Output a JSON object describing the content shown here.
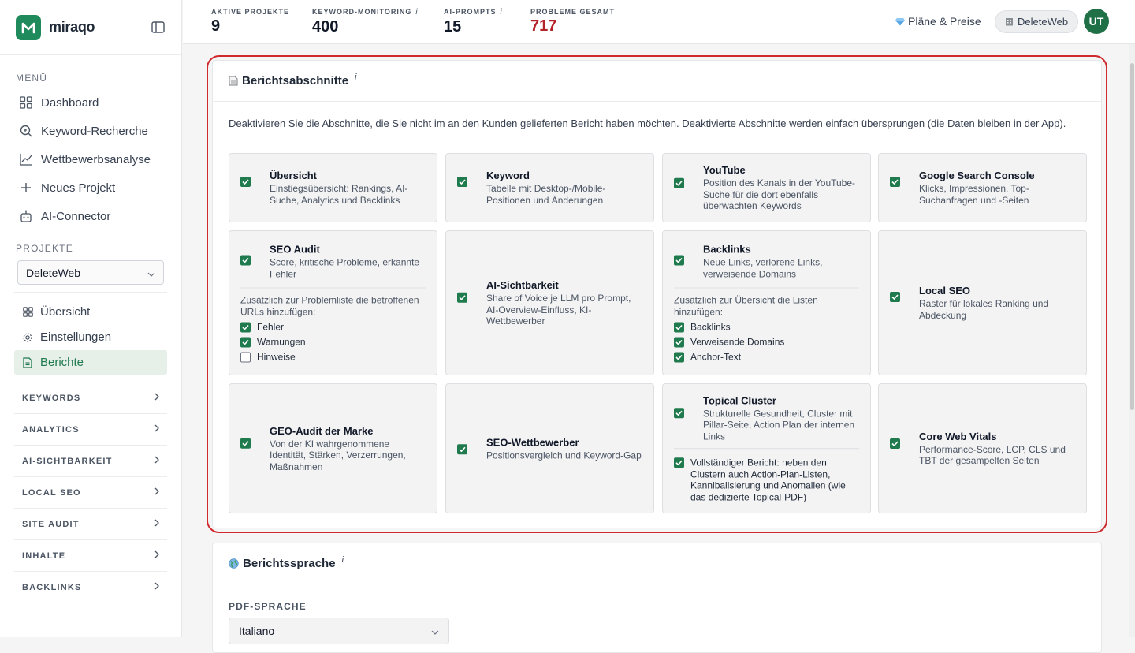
{
  "brand": {
    "name": "miraqo"
  },
  "menu": {
    "title": "MENÜ",
    "items": [
      {
        "label": "Dashboard",
        "icon": "grid-icon"
      },
      {
        "label": "Keyword-Recherche",
        "icon": "search-icon"
      },
      {
        "label": "Wettbewerbsanalyse",
        "icon": "chart-icon"
      },
      {
        "label": "Neues Projekt",
        "icon": "plus-icon"
      },
      {
        "label": "AI-Connector",
        "icon": "robot-icon"
      }
    ]
  },
  "projects": {
    "title": "PROJEKTE",
    "selected": "DeleteWeb",
    "sub_items": [
      {
        "label": "Übersicht",
        "icon": "grid-icon"
      },
      {
        "label": "Einstellungen",
        "icon": "gear-icon"
      },
      {
        "label": "Berichte",
        "icon": "document-icon",
        "active": true
      }
    ],
    "groups": [
      "KEYWORDS",
      "ANALYTICS",
      "AI-SICHTBARKEIT",
      "LOCAL SEO",
      "SITE AUDIT",
      "INHALTE",
      "BACKLINKS"
    ]
  },
  "stats": [
    {
      "label": "AKTIVE PROJEKTE",
      "value": "9",
      "info": "",
      "alert": false
    },
    {
      "label": "KEYWORD-MONITORING",
      "value": "400",
      "info": "i",
      "alert": false
    },
    {
      "label": "AI-PROMPTS",
      "value": "15",
      "info": "i",
      "alert": false
    },
    {
      "label": "PROBLEME GESAMT",
      "value": "717",
      "info": "",
      "alert": true
    }
  ],
  "header": {
    "plans_label": "Pläne & Preise",
    "workspace_label": "DeleteWeb",
    "avatar_initials": "UT"
  },
  "sections_card": {
    "title": "Berichtsabschnitte",
    "info": "i",
    "description": "Deaktivieren Sie die Abschnitte, die Sie nicht im an den Kunden gelieferten Bericht haben möchten. Deaktivierte Abschnitte werden einfach übersprungen (die Daten bleiben in der App).",
    "tiles": [
      {
        "title": "Übersicht",
        "desc": "Einstiegsübersicht: Rankings, AI-Suche, Analytics und Backlinks",
        "checked": true
      },
      {
        "title": "Keyword",
        "desc": "Tabelle mit Desktop-/Mobile-Positionen und Änderungen",
        "checked": true
      },
      {
        "title": "YouTube",
        "desc": "Position des Kanals in der YouTube-Suche für die dort ebenfalls überwachten Keywords",
        "checked": true
      },
      {
        "title": "Google Search Console",
        "desc": "Klicks, Impressionen, Top-Suchanfragen und -Seiten",
        "checked": true
      },
      {
        "title": "SEO Audit",
        "desc": "Score, kritische Probleme, erkannte Fehler",
        "checked": true,
        "extra_note": "Zusätzlich zur Problemliste die betroffenen URLs hinzufügen:",
        "options": [
          {
            "label": "Fehler",
            "checked": true
          },
          {
            "label": "Warnungen",
            "checked": true
          },
          {
            "label": "Hinweise",
            "checked": false
          }
        ]
      },
      {
        "title": "AI-Sichtbarkeit",
        "desc": "Share of Voice je LLM pro Prompt, AI-Overview-Einfluss, KI-Wettbewerber",
        "checked": true
      },
      {
        "title": "Backlinks",
        "desc": "Neue Links, verlorene Links, verweisende Domains",
        "checked": true,
        "extra_note": "Zusätzlich zur Übersicht die Listen hinzufügen:",
        "options": [
          {
            "label": "Backlinks",
            "checked": true
          },
          {
            "label": "Verweisende Domains",
            "checked": true
          },
          {
            "label": "Anchor-Text",
            "checked": true
          }
        ]
      },
      {
        "title": "Local SEO",
        "desc": "Raster für lokales Ranking und Abdeckung",
        "checked": true
      },
      {
        "title": "GEO-Audit der Marke",
        "desc": "Von der KI wahrgenommene Identität, Stärken, Verzerrungen, Maßnahmen",
        "checked": true
      },
      {
        "title": "SEO-Wettbewerber",
        "desc": "Positionsvergleich und Keyword-Gap",
        "checked": true
      },
      {
        "title": "Topical Cluster",
        "desc": "Strukturelle Gesundheit, Cluster mit Pillar-Seite, Action Plan der internen Links",
        "checked": true,
        "full_report": {
          "label": "Vollständiger Bericht: neben den Clustern auch Action-Plan-Listen, Kannibalisierung und Anomalien (wie das dedizierte Topical-PDF)",
          "checked": true
        }
      },
      {
        "title": "Core Web Vitals",
        "desc": "Performance-Score, LCP, CLS und TBT der gesampelten Seiten",
        "checked": true
      }
    ]
  },
  "language_card": {
    "title": "Berichtssprache",
    "info": "i",
    "pdf_label": "PDF-SPRACHE",
    "pdf_value": "Italiano"
  },
  "colors": {
    "brand": "#1f8a5b",
    "accent": "#1f7a4d",
    "highlight": "#cf2b2f",
    "alert": "#b42328"
  }
}
